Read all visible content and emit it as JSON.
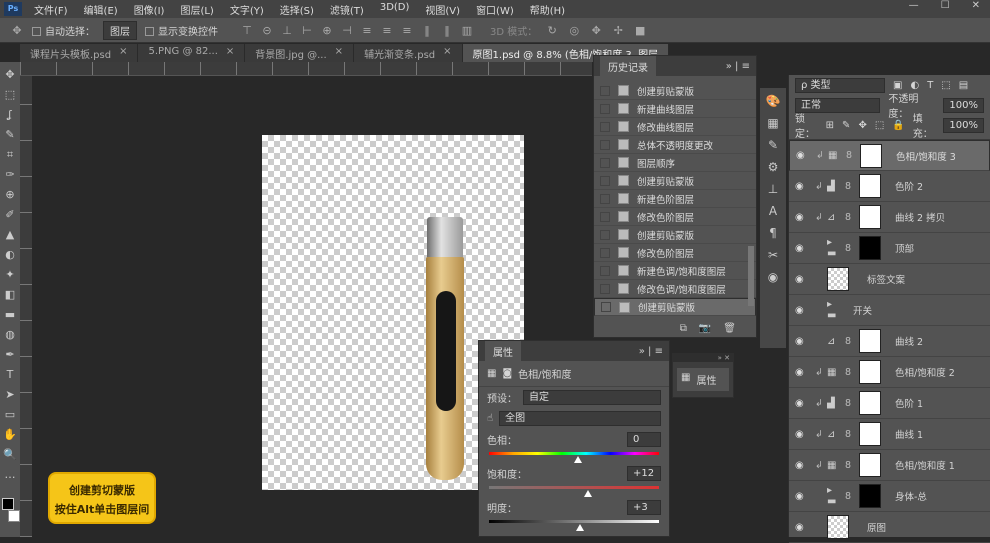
{
  "app": {
    "logo": "Ps"
  },
  "menu": [
    "文件(F)",
    "编辑(E)",
    "图像(I)",
    "图层(L)",
    "文字(Y)",
    "选择(S)",
    "滤镜(T)",
    "3D(D)",
    "视图(V)",
    "窗口(W)",
    "帮助(H)"
  ],
  "window_buttons": [
    "—",
    "☐",
    "✕"
  ],
  "options": {
    "auto_select_label": "自动选择：",
    "auto_select_value": "图层",
    "show_transform_label": "显示变换控件",
    "mode_3d": "3D 模式："
  },
  "tabs": [
    {
      "label": "课程片头模板.psd",
      "close": "×"
    },
    {
      "label": "5.PNG @ 82...",
      "close": "×"
    },
    {
      "label": "背景图.jpg @...",
      "close": "×"
    },
    {
      "label": "辅光渐变条.psd",
      "close": "×"
    },
    {
      "label": "原图1.psd @ 8.8% (色相/饱和度 3, 图层",
      "close": "×"
    }
  ],
  "tools": [
    "✥",
    "⬚",
    "ʆ",
    "✎",
    "⌗",
    "✑",
    "⊕",
    "✐",
    "▲",
    "◐",
    "✦",
    "◧",
    "▬",
    "◍",
    "✒",
    "T",
    "➤",
    "▭",
    "✋",
    "🔍",
    "…"
  ],
  "history": {
    "title": "历史记录",
    "items": [
      "创建剪贴蒙版",
      "新建曲线图层",
      "修改曲线图层",
      "总体不透明度更改",
      "图层顺序",
      "创建剪贴蒙版",
      "新建色阶图层",
      "修改色阶图层",
      "创建剪贴蒙版",
      "修改色阶图层",
      "新建色调/饱和度图层",
      "修改色调/饱和度图层",
      "创建剪贴蒙版"
    ],
    "selected": 12
  },
  "layers": {
    "filter": "ρ 类型",
    "blend": "正常",
    "opacity_label": "不透明度：",
    "opacity": "100%",
    "lock_label": "锁定：",
    "fill_label": "填充：",
    "fill": "100%",
    "items": [
      {
        "name": "色相/饱和度 3",
        "adj": "▦",
        "clip": true,
        "thumb": "white",
        "selected": true
      },
      {
        "name": "色阶 2",
        "adj": "▟",
        "clip": true,
        "thumb": "white"
      },
      {
        "name": "曲线 2 拷贝",
        "adj": "⊿",
        "clip": true,
        "thumb": "white"
      },
      {
        "name": "顶部",
        "adj": "▸ ▬",
        "clip": false,
        "thumb": "black"
      },
      {
        "name": "标签文案",
        "adj": "",
        "clip": false,
        "thumb": "checker"
      },
      {
        "name": "开关",
        "adj": "▸ ▬",
        "clip": false,
        "thumb": "none"
      },
      {
        "name": "曲线 2",
        "adj": "⊿",
        "clip": false,
        "thumb": "white"
      },
      {
        "name": "色相/饱和度 2",
        "adj": "▦",
        "clip": true,
        "thumb": "white"
      },
      {
        "name": "色阶 1",
        "adj": "▟",
        "clip": true,
        "thumb": "white"
      },
      {
        "name": "曲线 1",
        "adj": "⊿",
        "clip": true,
        "thumb": "white"
      },
      {
        "name": "色相/饱和度 1",
        "adj": "▦",
        "clip": true,
        "thumb": "white"
      },
      {
        "name": "身体-总",
        "adj": "▸ ▬",
        "clip": false,
        "thumb": "black"
      },
      {
        "name": "原图",
        "adj": "",
        "clip": false,
        "thumb": "checker"
      }
    ]
  },
  "properties": {
    "title": "属性",
    "type": "色相/饱和度",
    "preset_label": "预设：",
    "preset": "自定",
    "range": "全图",
    "hue_label": "色相：",
    "hue": "0",
    "sat_label": "饱和度：",
    "sat": "+12",
    "light_label": "明度：",
    "light": "+3",
    "hue_pos": 0.5,
    "sat_pos": 0.56,
    "light_pos": 0.51
  },
  "mini_panel": {
    "label": "属性"
  },
  "tooltip": {
    "line1": "创建剪切蒙版",
    "line2": "按住Alt单击图层间"
  },
  "colors": {
    "accent": "#f5c518"
  }
}
